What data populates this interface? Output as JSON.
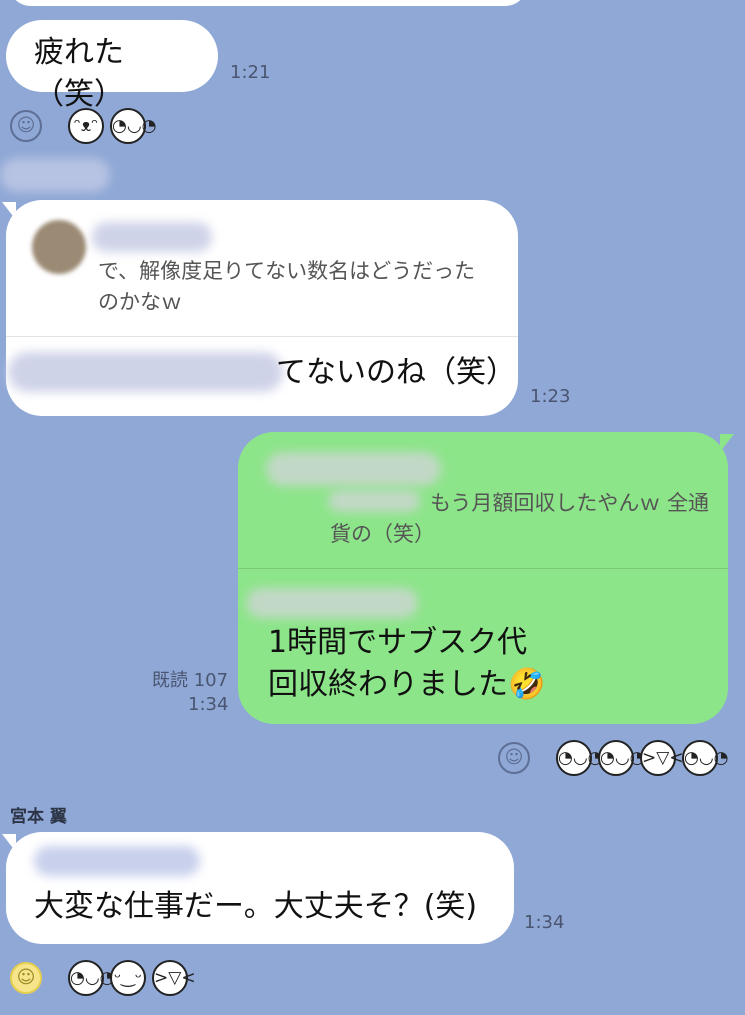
{
  "messages": {
    "m1": {
      "text": "疲れた（笑）",
      "time": "1:21"
    },
    "m2": {
      "quote": "で、解像度足りてない数名はどうだったのかなｗ",
      "text": "てないのね（笑）",
      "time": "1:23"
    },
    "m3": {
      "quote": "もう月額回収したやんｗ 全通貨の（笑）",
      "text_line1": "1時間でサブスク代",
      "text_line2": "回収終わりました🤣",
      "read": "既読 107",
      "time": "1:34"
    },
    "m4": {
      "sender": "宮本 翼",
      "text": "大変な仕事だー。大丈夫そ？(笑)",
      "time": "1:34"
    }
  },
  "icons": {
    "reaction": "smile-icon",
    "stickers": [
      "thumbs-up-face-sticker",
      "shy-face-sticker",
      "laughing-face-sticker",
      "grin-face-sticker"
    ]
  },
  "colors": {
    "background": "#8fa8d6",
    "incoming_bubble": "#ffffff",
    "outgoing_bubble": "#8de58a"
  }
}
